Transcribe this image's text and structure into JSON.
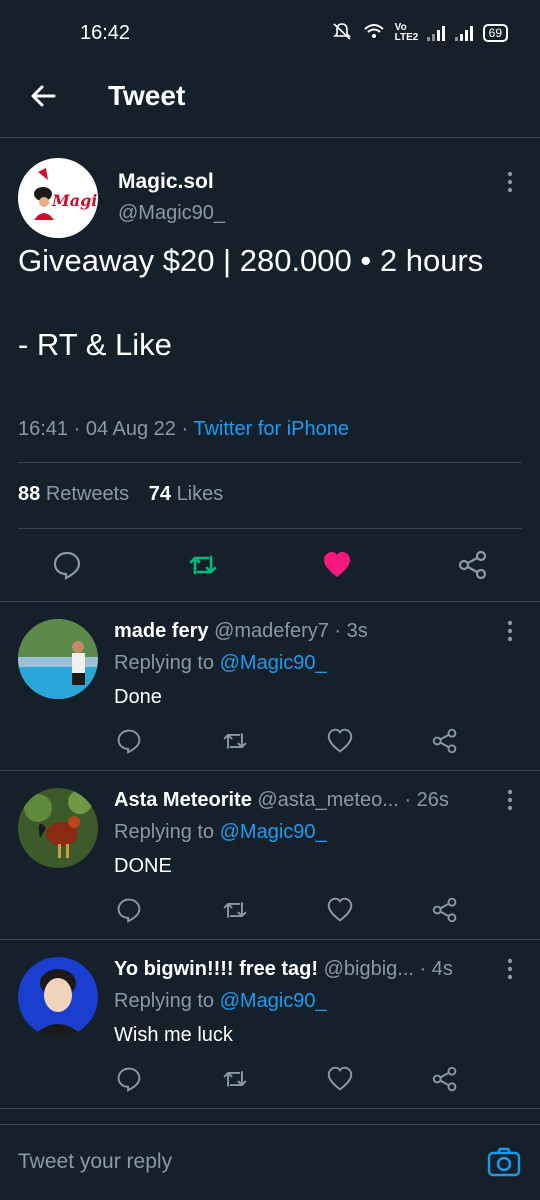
{
  "status_bar": {
    "time": "16:42",
    "network_label": "Vo LTE2",
    "battery": "69"
  },
  "header": {
    "title": "Tweet"
  },
  "main_tweet": {
    "avatar_text": "Magic",
    "name": "Magic.sol",
    "handle": "@Magic90_",
    "text": "Giveaway $20 | 280.000 • 2 hours\n\n- RT & Like",
    "time": "16:41",
    "date": "04 Aug 22",
    "source": "Twitter for iPhone",
    "retweets_count": "88",
    "retweets_label": "Retweets",
    "likes_count": "74",
    "likes_label": "Likes"
  },
  "colors": {
    "background": "#15202b",
    "accent": "#1d9bf0",
    "retweet_green": "#00ba7c",
    "like_pink": "#f91880",
    "muted": "#8b98a5"
  },
  "replies": [
    {
      "name": "made fery",
      "handle": "@madefery7",
      "time": "3s",
      "replying_label": "Replying to",
      "replying_to": "@Magic90_",
      "text": "Done"
    },
    {
      "name": "Asta Meteorite",
      "handle": "@asta_meteo...",
      "time": "26s",
      "replying_label": "Replying to",
      "replying_to": "@Magic90_",
      "text": "DONE"
    },
    {
      "name": "Yo bigwin!!!! free tag!",
      "handle": "@bigbig...",
      "time": "4s",
      "replying_label": "Replying to",
      "replying_to": "@Magic90_",
      "text": "Wish me luck"
    }
  ],
  "compose": {
    "placeholder": "Tweet your reply"
  }
}
